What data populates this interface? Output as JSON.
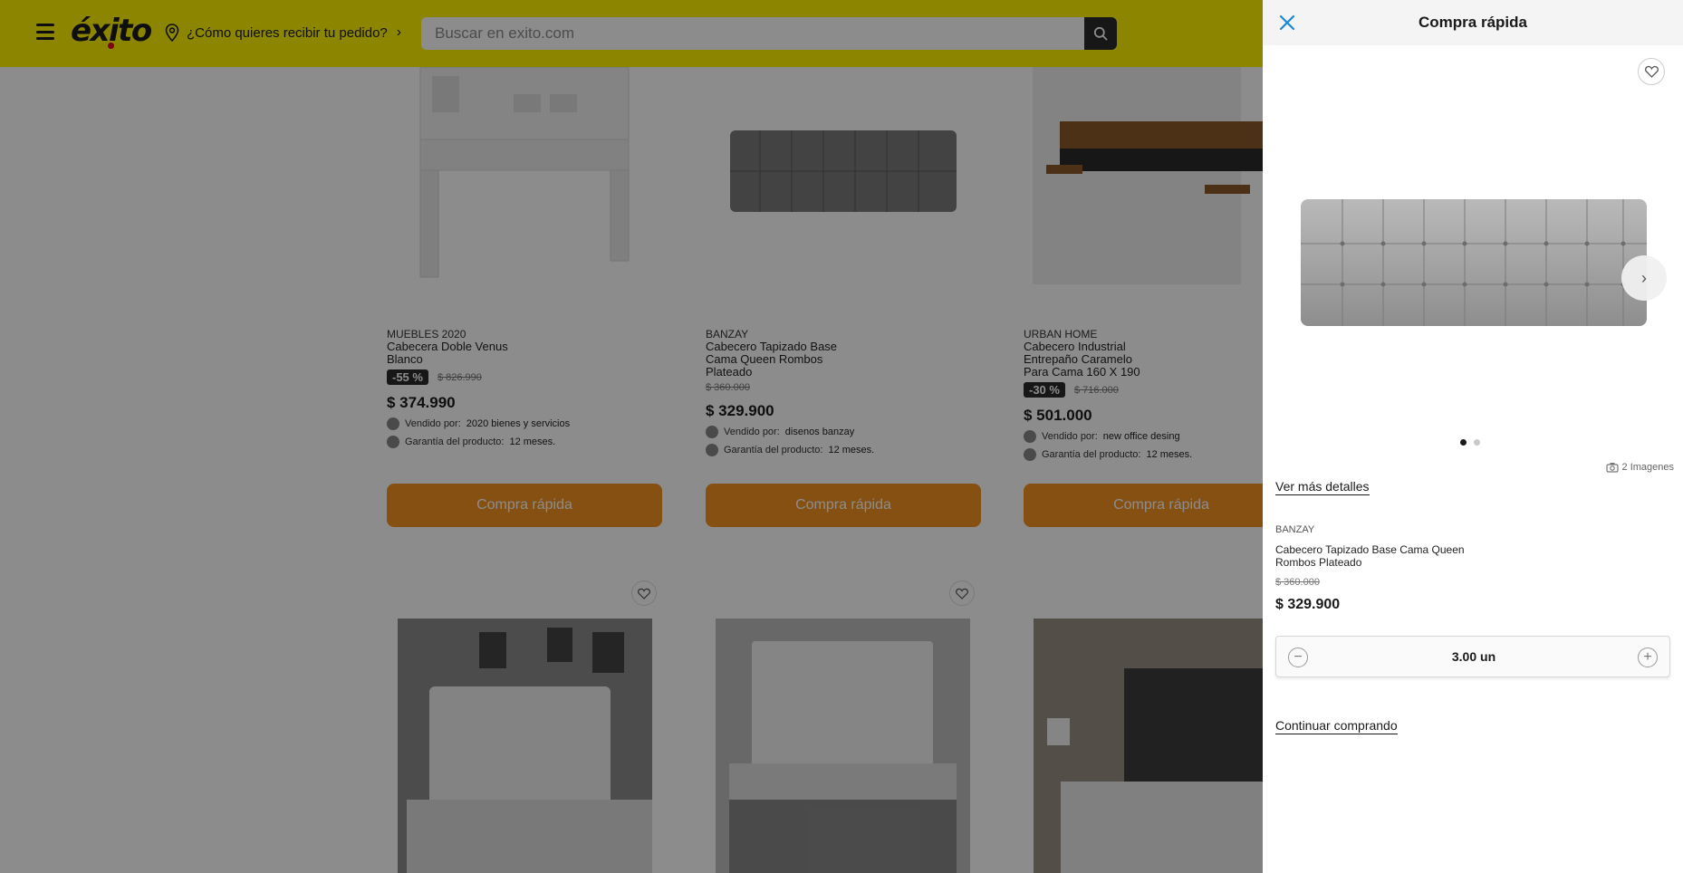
{
  "header": {
    "logo": "éxito",
    "location_prompt": "¿Cómo quieres recibir tu pedido?",
    "search_placeholder": "Buscar en exito.com"
  },
  "products": [
    {
      "brand": "MUEBLES 2020",
      "name": "Cabecera Doble Venus Blanco",
      "discount": "-55 %",
      "old_price": "$ 826.990",
      "price": "$ 374.990",
      "seller_label": "Vendido por:",
      "seller": "2020 bienes y servicios",
      "warranty_label": "Garantía del producto:",
      "warranty": "12 meses.",
      "cta": "Compra rápida"
    },
    {
      "brand": "BANZAY",
      "name": "Cabecero Tapizado Base Cama Queen Rombos Plateado",
      "discount": "",
      "old_price": "$ 360.000",
      "price": "$ 329.900",
      "seller_label": "Vendido por:",
      "seller": "disenos banzay",
      "warranty_label": "Garantía del producto:",
      "warranty": "12 meses.",
      "cta": "Compra rápida"
    },
    {
      "brand": "URBAN HOME",
      "name": "Cabecero Industrial Entrepaño Caramelo Para Cama 160 X 190",
      "discount": "-30 %",
      "old_price": "$ 716.000",
      "price": "$ 501.000",
      "seller_label": "Vendido por:",
      "seller": "new office desing",
      "warranty_label": "Garantía del producto:",
      "warranty": "12 meses.",
      "cta": "Compra rápida"
    }
  ],
  "quick_buy": {
    "title": "Compra rápida",
    "image_count": "2 Imagenes",
    "details_link": "Ver más detalles",
    "brand": "BANZAY",
    "name": "Cabecero Tapizado Base Cama Queen Rombos Plateado",
    "old_price": "$ 360.000",
    "price": "$ 329.900",
    "quantity": "3.00 un",
    "continue_link": "Continuar comprando",
    "carousel_active_index": 0,
    "carousel_total": 2
  },
  "colors": {
    "header_bg": "#fff200",
    "cta_orange": "#f29320",
    "discount_badge": "#2b2b2b"
  }
}
